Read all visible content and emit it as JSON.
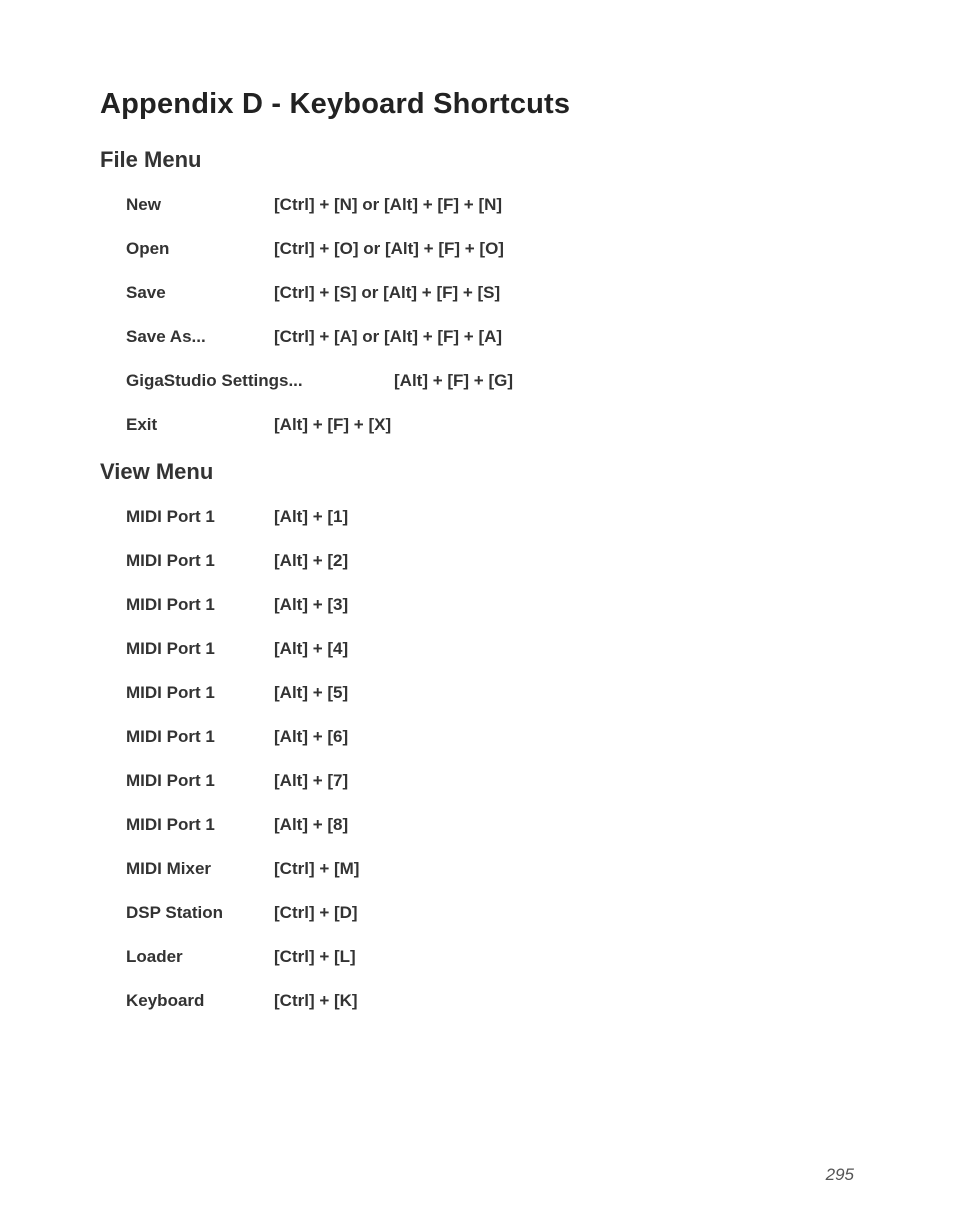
{
  "title": "Appendix D - Keyboard Shortcuts",
  "sections": [
    {
      "heading": "File Menu",
      "rows": [
        {
          "label": "New",
          "value": "[Ctrl] + [N] or [Alt] + [F] + [N]",
          "wide": false
        },
        {
          "label": "Open",
          "value": "[Ctrl] + [O] or [Alt] + [F] + [O]",
          "wide": false
        },
        {
          "label": "Save",
          "value": "[Ctrl] + [S] or [Alt] + [F] + [S]",
          "wide": false
        },
        {
          "label": "Save As...",
          "value": "[Ctrl] + [A] or [Alt] + [F] + [A]",
          "wide": false
        },
        {
          "label": "GigaStudio Settings...",
          "value": "[Alt] + [F] + [G]",
          "wide": true
        },
        {
          "label": "Exit",
          "value": "[Alt] + [F] + [X]",
          "wide": false
        }
      ]
    },
    {
      "heading": "View Menu",
      "rows": [
        {
          "label": "MIDI Port 1",
          "value": "[Alt] + [1]",
          "wide": false
        },
        {
          "label": "MIDI Port 1",
          "value": "[Alt] + [2]",
          "wide": false
        },
        {
          "label": "MIDI Port 1",
          "value": "[Alt] + [3]",
          "wide": false
        },
        {
          "label": "MIDI Port 1",
          "value": "[Alt] + [4]",
          "wide": false
        },
        {
          "label": "MIDI Port 1",
          "value": "[Alt] + [5]",
          "wide": false
        },
        {
          "label": "MIDI Port 1",
          "value": "[Alt] + [6]",
          "wide": false
        },
        {
          "label": "MIDI Port 1",
          "value": "[Alt] + [7]",
          "wide": false
        },
        {
          "label": "MIDI Port 1",
          "value": "[Alt] + [8]",
          "wide": false
        },
        {
          "label": "MIDI Mixer",
          "value": "[Ctrl] + [M]",
          "wide": false
        },
        {
          "label": "DSP Station",
          "value": "[Ctrl] + [D]",
          "wide": false
        },
        {
          "label": "Loader",
          "value": "[Ctrl] + [L]",
          "wide": false
        },
        {
          "label": "Keyboard",
          "value": "[Ctrl] + [K]",
          "wide": false
        }
      ]
    }
  ],
  "pageNumber": "295"
}
